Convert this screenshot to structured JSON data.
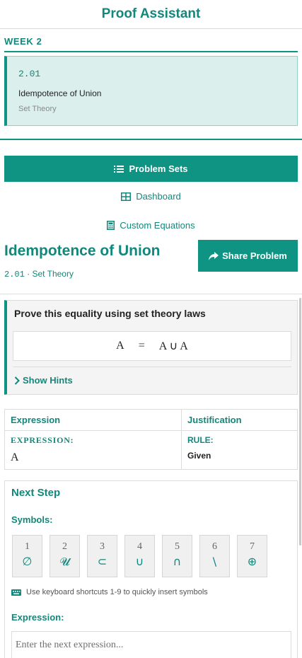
{
  "app": {
    "title": "Proof Assistant"
  },
  "week": {
    "label": "WEEK 2",
    "card": {
      "code": "2.01",
      "title": "Idempotence of Union",
      "subtitle": "Set Theory"
    }
  },
  "nav": {
    "problem_sets": "Problem Sets",
    "dashboard": "Dashboard",
    "custom_equations": "Custom Equations"
  },
  "problem": {
    "title": "Idempotence of Union",
    "code": "2.01",
    "separator": " · ",
    "category": "Set Theory",
    "share_label": "Share Problem",
    "prove_label": "Prove this equality using set theory laws",
    "equation": {
      "lhs": "A",
      "op": "=",
      "rhs": "A ∪ A"
    },
    "hints_label": "Show Hints"
  },
  "proof_table": {
    "headers": [
      "Expression",
      "Justification"
    ],
    "rows": [
      {
        "expr_label": "EXPRESSION:",
        "expr_value": "A",
        "rule_label": "RULE:",
        "rule_value": "Given"
      }
    ]
  },
  "next_step": {
    "title": "Next Step",
    "symbols_label": "Symbols:",
    "symbols": [
      {
        "num": "1",
        "glyph": "∅"
      },
      {
        "num": "2",
        "glyph": "𝓤"
      },
      {
        "num": "3",
        "glyph": "⊂"
      },
      {
        "num": "4",
        "glyph": "∪"
      },
      {
        "num": "5",
        "glyph": "∩"
      },
      {
        "num": "6",
        "glyph": "\\"
      },
      {
        "num": "7",
        "glyph": "⊕"
      }
    ],
    "keyboard_hint": "Use keyboard shortcuts 1-9 to quickly insert symbols",
    "expression_label": "Expression:",
    "expression_placeholder": "Enter the next expression..."
  },
  "colors": {
    "accent": "#0f9483",
    "accent_text": "#12877b",
    "card_bg": "#dbefec",
    "panel_bg": "#f4f4f4"
  }
}
